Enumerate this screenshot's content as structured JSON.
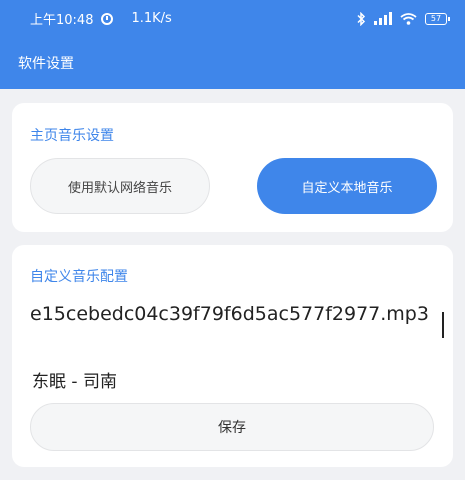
{
  "status_bar": {
    "time": "上午10:48",
    "network_speed": "1.1K/s",
    "battery": "57",
    "icons": [
      "clock-icon",
      "bluetooth-icon",
      "signal-icon",
      "wifi-icon",
      "battery-icon"
    ]
  },
  "app_bar": {
    "title": "软件设置"
  },
  "home_music": {
    "title": "主页音乐设置",
    "default_button": "使用默认网络音乐",
    "custom_button": "自定义本地音乐"
  },
  "custom_music": {
    "title": "自定义音乐配置",
    "file_value": "e15cebedc04c39f79f6d5ac577f2977.mp3",
    "song_name": "东眠 - 司南",
    "save_button": "保存"
  },
  "colors": {
    "accent": "#3f86ea",
    "background": "#f0f1f4"
  }
}
